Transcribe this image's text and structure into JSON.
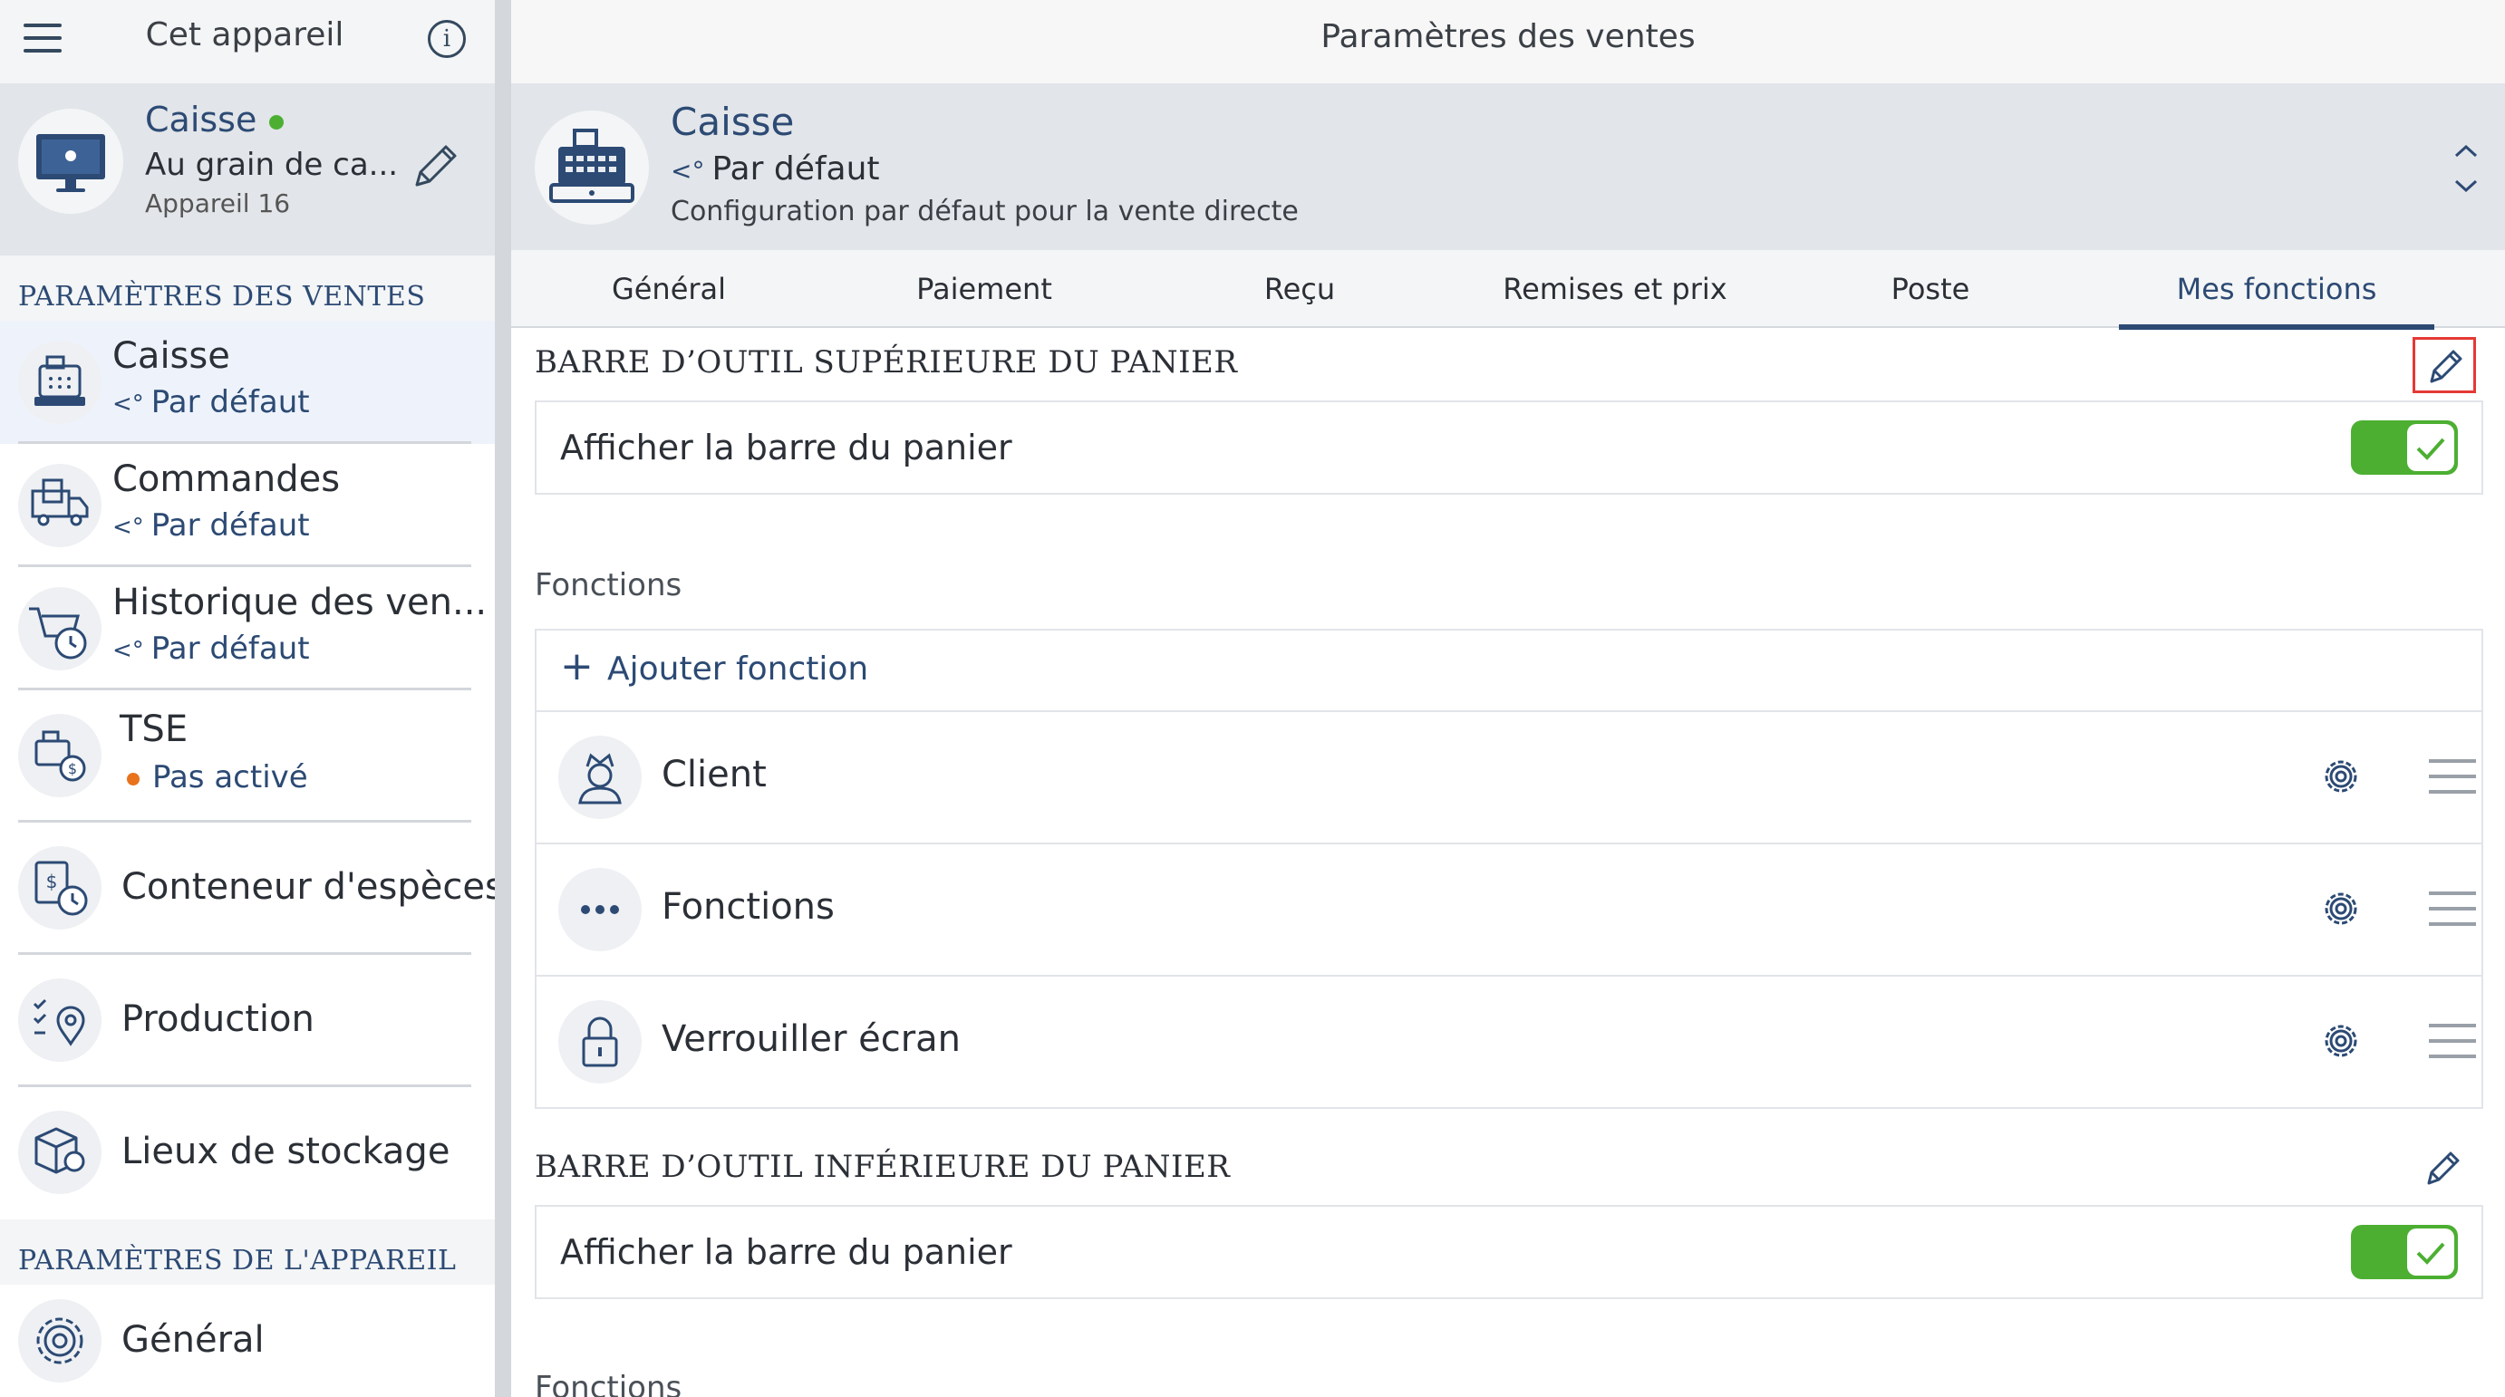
{
  "left_panel": {
    "header": {
      "title": "Cet appareil"
    },
    "device": {
      "name": "Caisse",
      "status_color": "#4caf32",
      "subtitle": "Au grain de ca...",
      "meta": "Appareil 16"
    },
    "sales_section": "PARAMÈTRES DES VENTES",
    "sales_items": [
      {
        "title": "Caisse",
        "subtitle": "Par défaut",
        "icon": "cash-register-icon"
      },
      {
        "title": "Commandes",
        "subtitle": "Par défaut",
        "icon": "delivery-truck-icon"
      },
      {
        "title": "Historique des ven...",
        "subtitle": "Par défaut",
        "icon": "cart-history-icon"
      },
      {
        "title": "TSE",
        "subtitle": "Pas activé",
        "icon": "tse-icon"
      },
      {
        "title": "Conteneur d'espèces",
        "icon": "cash-container-icon"
      },
      {
        "title": "Production",
        "icon": "production-icon"
      },
      {
        "title": "Lieux de stockage",
        "icon": "storage-location-icon"
      }
    ],
    "device_section": "PARAMÈTRES DE L'APPAREIL",
    "device_items": [
      {
        "title": "Général",
        "icon": "gear-icon"
      }
    ]
  },
  "right_panel": {
    "header": {
      "title": "Paramètres des ventes"
    },
    "card": {
      "title": "Caisse",
      "subtitle": "Par défaut",
      "description": "Configuration par défaut pour la vente directe"
    },
    "tabs": [
      "Général",
      "Paiement",
      "Reçu",
      "Remises et prix",
      "Poste",
      "Mes fonctions"
    ],
    "selected_tab": "Mes fonctions",
    "top_section": {
      "title": "BARRE D’OUTIL SUPÉRIEURE DU PANIER",
      "toggle_label": "Afficher la barre du panier",
      "toggle_on": true,
      "functions_heading": "Fonctions",
      "add_function": "Ajouter fonction",
      "functions": [
        {
          "label": "Client",
          "icon": "client-icon"
        },
        {
          "label": "Fonctions",
          "icon": "more-dots-icon"
        },
        {
          "label": "Verrouiller écran",
          "icon": "lock-icon"
        }
      ]
    },
    "bottom_section": {
      "title": "BARRE D’OUTIL INFÉRIEURE DU PANIER",
      "toggle_label": "Afficher la barre du panier",
      "toggle_on": true,
      "functions_heading": "Fonctions"
    }
  },
  "colors": {
    "accent": "#2c4a74",
    "toggle_on": "#4caf32",
    "highlight": "#e53935",
    "warning_dot": "#e8731c"
  }
}
